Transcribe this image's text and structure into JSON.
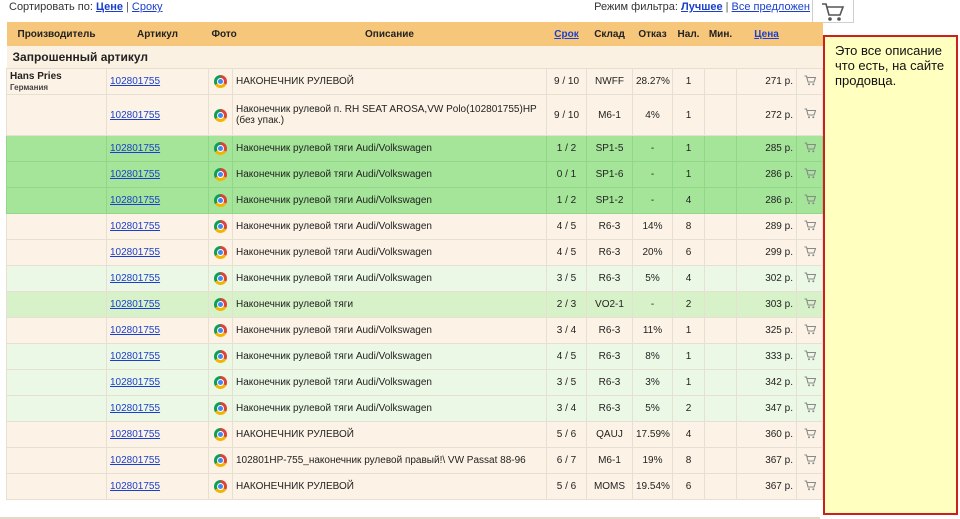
{
  "sort": {
    "label": "Сортировать по:",
    "by_price": "Цене",
    "by_term": "Сроку"
  },
  "filter": {
    "label": "Режим фильтра:",
    "best": "Лучшее",
    "all": "Все предложен"
  },
  "headers": {
    "maker": "Производитель",
    "article": "Артикул",
    "photo": "Фото",
    "desc": "Описание",
    "term": "Срок",
    "warehouse": "Склад",
    "refusal": "Отказ",
    "avail": "Нал.",
    "min": "Мин.",
    "price": "Цена"
  },
  "section_title": "Запрошенный артикул",
  "maker": {
    "name": "Hans Pries",
    "country": "Германия"
  },
  "rows": [
    {
      "article": "102801755",
      "desc": "НАКОНЕЧНИК РУЛЕВОЙ",
      "term": "9 / 10",
      "wh": "NWFF",
      "refusal": "28.27%",
      "avail": "1",
      "min": "",
      "price": "271 р.",
      "style": "cream"
    },
    {
      "article": "102801755",
      "desc": "Наконечник рулевой п. RH SEAT AROSA,VW Polo(102801755)HP (без упак.)",
      "term": "9 / 10",
      "wh": "M6-1",
      "refusal": "4%",
      "avail": "1",
      "min": "",
      "price": "272 р.",
      "style": "cream tall"
    },
    {
      "article": "102801755",
      "desc": "Наконечник рулевой тяги Audi/Volkswagen",
      "term": "1 / 2",
      "wh": "SP1-5",
      "refusal": "-",
      "avail": "1",
      "min": "",
      "price": "285 р.",
      "style": "green"
    },
    {
      "article": "102801755",
      "desc": "Наконечник рулевой тяги Audi/Volkswagen",
      "term": "0 / 1",
      "wh": "SP1-6",
      "refusal": "-",
      "avail": "1",
      "min": "",
      "price": "286 р.",
      "style": "green"
    },
    {
      "article": "102801755",
      "desc": "Наконечник рулевой тяги Audi/Volkswagen",
      "term": "1 / 2",
      "wh": "SP1-2",
      "refusal": "-",
      "avail": "4",
      "min": "",
      "price": "286 р.",
      "style": "green"
    },
    {
      "article": "102801755",
      "desc": "Наконечник рулевой тяги Audi/Volkswagen",
      "term": "4 / 5",
      "wh": "R6-3",
      "refusal": "14%",
      "avail": "8",
      "min": "",
      "price": "289 р.",
      "style": "cream"
    },
    {
      "article": "102801755",
      "desc": "Наконечник рулевой тяги Audi/Volkswagen",
      "term": "4 / 5",
      "wh": "R6-3",
      "refusal": "20%",
      "avail": "6",
      "min": "",
      "price": "299 р.",
      "style": "cream"
    },
    {
      "article": "102801755",
      "desc": "Наконечник рулевой тяги Audi/Volkswagen",
      "term": "3 / 5",
      "wh": "R6-3",
      "refusal": "5%",
      "avail": "4",
      "min": "",
      "price": "302 р.",
      "style": "lightgreen"
    },
    {
      "article": "102801755",
      "desc": "Наконечник рулевой тяги",
      "term": "2 / 3",
      "wh": "VO2-1",
      "refusal": "-",
      "avail": "2",
      "min": "",
      "price": "303 р.",
      "style": "midgreen"
    },
    {
      "article": "102801755",
      "desc": "Наконечник рулевой тяги Audi/Volkswagen",
      "term": "3 / 4",
      "wh": "R6-3",
      "refusal": "11%",
      "avail": "1",
      "min": "",
      "price": "325 р.",
      "style": "cream"
    },
    {
      "article": "102801755",
      "desc": "Наконечник рулевой тяги Audi/Volkswagen",
      "term": "4 / 5",
      "wh": "R6-3",
      "refusal": "8%",
      "avail": "1",
      "min": "",
      "price": "333 р.",
      "style": "lightgreen"
    },
    {
      "article": "102801755",
      "desc": "Наконечник рулевой тяги Audi/Volkswagen",
      "term": "3 / 5",
      "wh": "R6-3",
      "refusal": "3%",
      "avail": "1",
      "min": "",
      "price": "342 р.",
      "style": "lightgreen"
    },
    {
      "article": "102801755",
      "desc": "Наконечник рулевой тяги Audi/Volkswagen",
      "term": "3 / 4",
      "wh": "R6-3",
      "refusal": "5%",
      "avail": "2",
      "min": "",
      "price": "347 р.",
      "style": "lightgreen"
    },
    {
      "article": "102801755",
      "desc": "НАКОНЕЧНИК РУЛЕВОЙ",
      "term": "5 / 6",
      "wh": "QAUJ",
      "refusal": "17.59%",
      "avail": "4",
      "min": "",
      "price": "360 р.",
      "style": "cream"
    },
    {
      "article": "102801755",
      "desc": "102801HP-755_наконечник рулевой правый!\\ VW Passat 88-96",
      "term": "6 / 7",
      "wh": "M6-1",
      "refusal": "19%",
      "avail": "8",
      "min": "",
      "price": "367 р.",
      "style": "cream"
    },
    {
      "article": "102801755",
      "desc": "НАКОНЕЧНИК РУЛЕВОЙ",
      "term": "5 / 6",
      "wh": "MOMS",
      "refusal": "19.54%",
      "avail": "6",
      "min": "",
      "price": "367 р.",
      "style": "cream"
    }
  ],
  "note": "Это все описание что есть, на сайте продовца.",
  "icons": {
    "top_cart": "shopping-cart-icon",
    "row_cart": "add-to-cart-icon",
    "photo": "chrome-photo-icon"
  }
}
